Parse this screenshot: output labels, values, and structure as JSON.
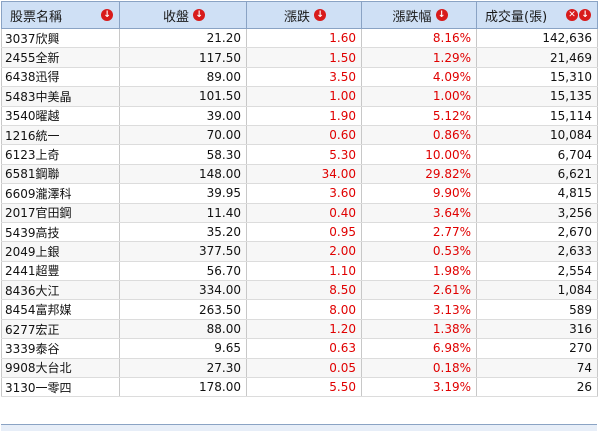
{
  "table": {
    "headers": [
      {
        "label": "股票名稱",
        "icons": [
          "sort-down"
        ]
      },
      {
        "label": "收盤",
        "icons": [
          "sort-down"
        ]
      },
      {
        "label": "漲跌",
        "icons": [
          "sort-down"
        ]
      },
      {
        "label": "漲跌幅",
        "icons": [
          "sort-down"
        ]
      },
      {
        "label": "成交量(張)",
        "icons": [
          "sort-clear",
          "sort-down"
        ]
      }
    ],
    "rows": [
      {
        "name": "3037欣興",
        "close": "21.20",
        "change": "1.60",
        "pct": "8.16%",
        "volume": "142,636"
      },
      {
        "name": "2455全新",
        "close": "117.50",
        "change": "1.50",
        "pct": "1.29%",
        "volume": "21,469"
      },
      {
        "name": "6438迅得",
        "close": "89.00",
        "change": "3.50",
        "pct": "4.09%",
        "volume": "15,310"
      },
      {
        "name": "5483中美晶",
        "close": "101.50",
        "change": "1.00",
        "pct": "1.00%",
        "volume": "15,135"
      },
      {
        "name": "3540曜越",
        "close": "39.00",
        "change": "1.90",
        "pct": "5.12%",
        "volume": "15,114"
      },
      {
        "name": "1216統一",
        "close": "70.00",
        "change": "0.60",
        "pct": "0.86%",
        "volume": "10,084"
      },
      {
        "name": "6123上奇",
        "close": "58.30",
        "change": "5.30",
        "pct": "10.00%",
        "volume": "6,704"
      },
      {
        "name": "6581鋼聯",
        "close": "148.00",
        "change": "34.00",
        "pct": "29.82%",
        "volume": "6,621"
      },
      {
        "name": "6609瀧澤科",
        "close": "39.95",
        "change": "3.60",
        "pct": "9.90%",
        "volume": "4,815"
      },
      {
        "name": "2017官田鋼",
        "close": "11.40",
        "change": "0.40",
        "pct": "3.64%",
        "volume": "3,256"
      },
      {
        "name": "5439高技",
        "close": "35.20",
        "change": "0.95",
        "pct": "2.77%",
        "volume": "2,670"
      },
      {
        "name": "2049上銀",
        "close": "377.50",
        "change": "2.00",
        "pct": "0.53%",
        "volume": "2,633"
      },
      {
        "name": "2441超豐",
        "close": "56.70",
        "change": "1.10",
        "pct": "1.98%",
        "volume": "2,554"
      },
      {
        "name": "8436大江",
        "close": "334.00",
        "change": "8.50",
        "pct": "2.61%",
        "volume": "1,084"
      },
      {
        "name": "8454富邦媒",
        "close": "263.50",
        "change": "8.00",
        "pct": "3.13%",
        "volume": "589"
      },
      {
        "name": "6277宏正",
        "close": "88.00",
        "change": "1.20",
        "pct": "1.38%",
        "volume": "316"
      },
      {
        "name": "3339泰谷",
        "close": "9.65",
        "change": "0.63",
        "pct": "6.98%",
        "volume": "270"
      },
      {
        "name": "9908大台北",
        "close": "27.30",
        "change": "0.05",
        "pct": "0.18%",
        "volume": "74"
      },
      {
        "name": "3130一零四",
        "close": "178.00",
        "change": "5.50",
        "pct": "3.19%",
        "volume": "26"
      }
    ]
  },
  "colors": {
    "header_bg": "#cfe0f5",
    "up_text": "#e00000",
    "sort_icon": "#d81b1b"
  }
}
